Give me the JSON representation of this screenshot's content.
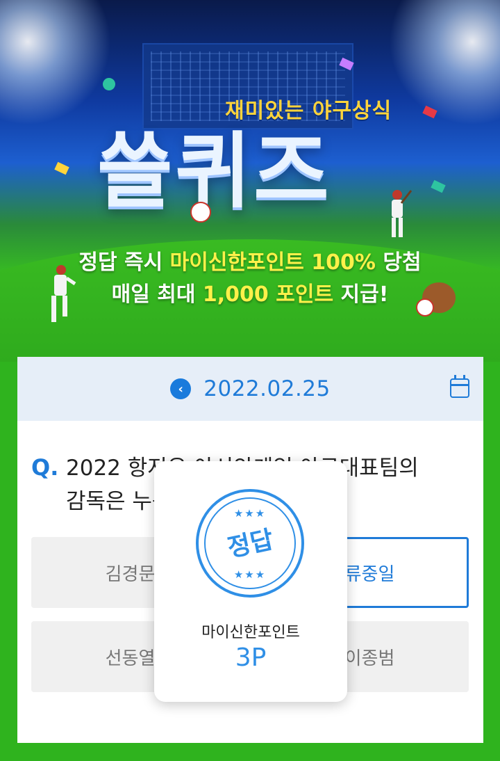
{
  "banner": {
    "subtitle": "재미있는 야구상식",
    "title": "쓸퀴즈",
    "promo_line1_a": "정답 즉시 ",
    "promo_line1_b": "마이신한포인트 100%",
    "promo_line1_c": " 당첨",
    "promo_line2_a": "매일 최대 ",
    "promo_line2_b": "1,000 포인트",
    "promo_line2_c": " 지급!",
    "accent_color": "#fff14a"
  },
  "date_nav": {
    "prev_icon": "chevron-left-icon",
    "date": "2022.02.25",
    "calendar_icon": "calendar-icon"
  },
  "quiz": {
    "prefix": "Q.",
    "question_line1": "2022 항저우 아시안게임 야구대표팀의",
    "question_line2": "감독은 누구일까요?",
    "options": [
      {
        "label": "김경문"
      },
      {
        "label": "류중일",
        "selected": true
      },
      {
        "label": "선동열"
      },
      {
        "label": "이종범"
      }
    ]
  },
  "result_popup": {
    "stamp_text": "정답",
    "stars": "★★★",
    "reward_label": "마이신한포인트",
    "reward_value": "3P",
    "color": "#2f8fe6"
  }
}
